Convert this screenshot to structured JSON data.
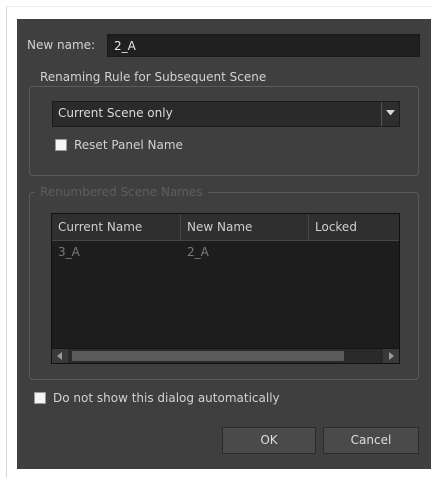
{
  "rename": {
    "label": "New name:",
    "value": "2_A"
  },
  "renaming_rule": {
    "legend": "Renaming Rule for Subsequent Scene",
    "selected": "Current Scene only",
    "reset_panel_label": "Reset Panel Name",
    "reset_panel_checked": false
  },
  "renumbered": {
    "legend": "Renumbered Scene Names",
    "columns": [
      "Current Name",
      "New Name",
      "Locked"
    ],
    "rows": [
      {
        "current": "3_A",
        "new": "2_A",
        "locked": ""
      }
    ]
  },
  "footer": {
    "dont_show_label": "Do not show this dialog automatically",
    "dont_show_checked": false,
    "ok_label": "OK",
    "cancel_label": "Cancel"
  },
  "icons": {
    "combo_arrow": "chevron-down-icon",
    "scroll_left": "arrow-left-icon",
    "scroll_right": "arrow-right-icon"
  }
}
